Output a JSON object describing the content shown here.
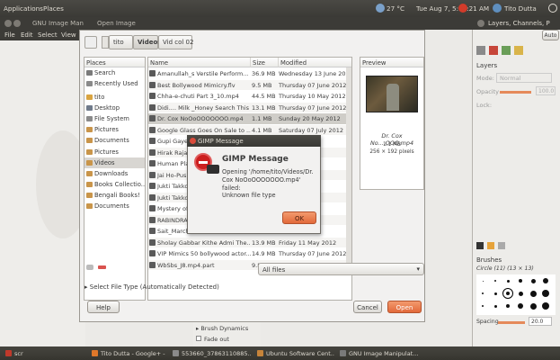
{
  "top_panel": {
    "applications": "Applications",
    "places": "Places",
    "temperature": "27 °C",
    "datetime": "Tue Aug 7, 5:15:21 AM",
    "user": "Tito Dutta"
  },
  "gimp_window": {
    "title": "GNU Image Man",
    "open_image": "Open Image",
    "menu": [
      "File",
      "Edit",
      "Select",
      "View"
    ]
  },
  "open_dialog": {
    "breadcrumbs": [
      "tito",
      "Videos",
      "Vid col 02"
    ],
    "places_header": "Places",
    "places": [
      {
        "label": "Search",
        "color": "#7a7a7a"
      },
      {
        "label": "Recently Used",
        "color": "#8a8a8a"
      },
      {
        "label": "tito",
        "color": "#d9a441"
      },
      {
        "label": "Desktop",
        "color": "#6f7a8a"
      },
      {
        "label": "File System",
        "color": "#8a8a8a"
      },
      {
        "label": "Pictures",
        "color": "#c9954a"
      },
      {
        "label": "Documents",
        "color": "#c9954a"
      },
      {
        "label": "Pictures",
        "color": "#c9954a"
      },
      {
        "label": "Videos",
        "color": "#c9954a"
      },
      {
        "label": "Downloads",
        "color": "#c9954a"
      },
      {
        "label": "Books Collectio...",
        "color": "#c9954a"
      },
      {
        "label": "Bengali Books!",
        "color": "#c9954a"
      },
      {
        "label": "Documents",
        "color": "#c9954a"
      }
    ],
    "columns": {
      "name": "Name",
      "size": "Size",
      "modified": "Modified"
    },
    "files": [
      {
        "name": "Amanullah_s Verstile Perform...",
        "size": "36.9 MB",
        "modified": "Wednesday 13 June 2012"
      },
      {
        "name": "Best Bollywood Mimicry.flv",
        "size": "9.5 MB",
        "modified": "Thursday 07 June 2012"
      },
      {
        "name": "Chha-e-chuti Part 3_10.mp4",
        "size": "44.5 MB",
        "modified": "Thursday 10 May 2012"
      },
      {
        "name": "Didi.... Milk _Honey Search This",
        "size": "13.1 MB",
        "modified": "Thursday 07 June 2012"
      },
      {
        "name": "Dr. Cox NoOoOOOOOOO.mp4",
        "size": "1.1 MB",
        "modified": "Sunday 20 May 2012"
      },
      {
        "name": "Google Glass Goes On Sale to ...",
        "size": "4.1 MB",
        "modified": "Saturday 07 July 2012"
      },
      {
        "name": "Gupi Gayen",
        "size": "",
        "modified": "2012"
      },
      {
        "name": "Hirak Rajan",
        "size": "",
        "modified": "2012"
      },
      {
        "name": "Human Pla",
        "size": "",
        "modified": "2012"
      },
      {
        "name": "Jai Ho-Pus",
        "size": "",
        "modified": "2012"
      },
      {
        "name": "Jukti Takko",
        "size": "",
        "modified": "2012"
      },
      {
        "name": "Jukti Takko",
        "size": "",
        "modified": "2012"
      },
      {
        "name": "Mystery of",
        "size": "",
        "modified": "2012"
      },
      {
        "name": "RABINDRA",
        "size": "",
        "modified": "2012"
      },
      {
        "name": "Sait_March",
        "size": "",
        "modified": "2012"
      },
      {
        "name": "Sholay Gabbar Kithe Admi The...",
        "size": "13.9 MB",
        "modified": "Friday 11 May 2012"
      },
      {
        "name": "VIP Mimics 50 bollywood actor...",
        "size": "14.9 MB",
        "modified": "Thursday 07 June 2012"
      },
      {
        "name": "WbSbs_J8.mp4.part",
        "size": "9.8 MB",
        "modified": "Wednesday 09 May 2012"
      }
    ],
    "selected_file_index": 4,
    "preview_header": "Preview",
    "preview_filename": "Dr. Cox No....OOO.mp4",
    "preview_size": "1.1 MB",
    "preview_dims": "256 × 192 pixels",
    "filter": "All files",
    "select_file_type": "Select File Type (Automatically Detected)",
    "help": "Help",
    "cancel": "Cancel",
    "open": "Open"
  },
  "gimp_message": {
    "window_title": "GIMP Message",
    "heading": "GIMP Message",
    "body": "Opening '/home/tito/Videos/Dr. Cox NoOoOOOOOOO.mp4' failed:",
    "detail": "Unknown file type",
    "ok": "OK"
  },
  "dock": {
    "title": "Layers, Channels, P",
    "auto": "Auto",
    "layers_title": "Layers",
    "mode_label": "Mode:",
    "mode_value": "Normal",
    "opacity_label": "Opacity",
    "opacity_value": "100.0",
    "lock_label": "Lock:",
    "brushes_title": "Brushes",
    "brush_name": "Circle (11) (13 × 13)",
    "spacing_label": "Spacing",
    "spacing_value": "20.0"
  },
  "toolbox_fragments": {
    "brush_dynamics": "Brush Dynamics",
    "fade_out": "Fade out"
  },
  "taskbar": [
    {
      "label": "scr",
      "color": "#c0392b"
    },
    {
      "label": "Tito Dutta - Google+ - ...",
      "color": "#e0782a"
    },
    {
      "label": "553660_37863110885...",
      "color": "#8a8a8a"
    },
    {
      "label": "Ubuntu Software Cent...",
      "color": "#c7843a"
    },
    {
      "label": "GNU Image Manipulat...",
      "color": "#7a7a7a"
    }
  ],
  "colors": {
    "accent_orange": "#e26b3b",
    "selection": "#d8d6d2",
    "panel": "#3c3b37"
  }
}
